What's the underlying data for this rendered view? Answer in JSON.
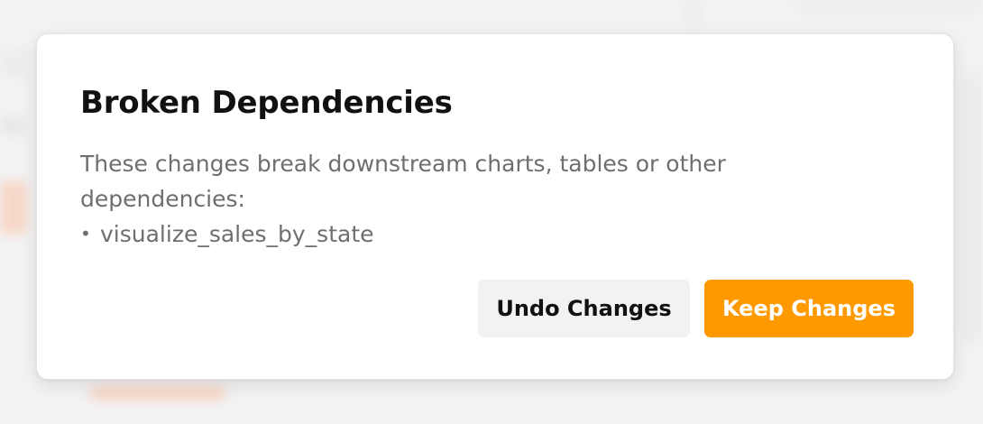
{
  "dialog": {
    "title": "Broken Dependencies",
    "message": "These changes break downstream charts, tables or other dependencies:",
    "bullet": "•",
    "dependencies": [
      "visualize_sales_by_state"
    ],
    "undo_label": "Undo Changes",
    "keep_label": "Keep Changes"
  },
  "colors": {
    "accent": "#ff9900",
    "secondary_button": "#f2f2f3",
    "title_text": "#111113",
    "body_text": "#6e6e73"
  }
}
